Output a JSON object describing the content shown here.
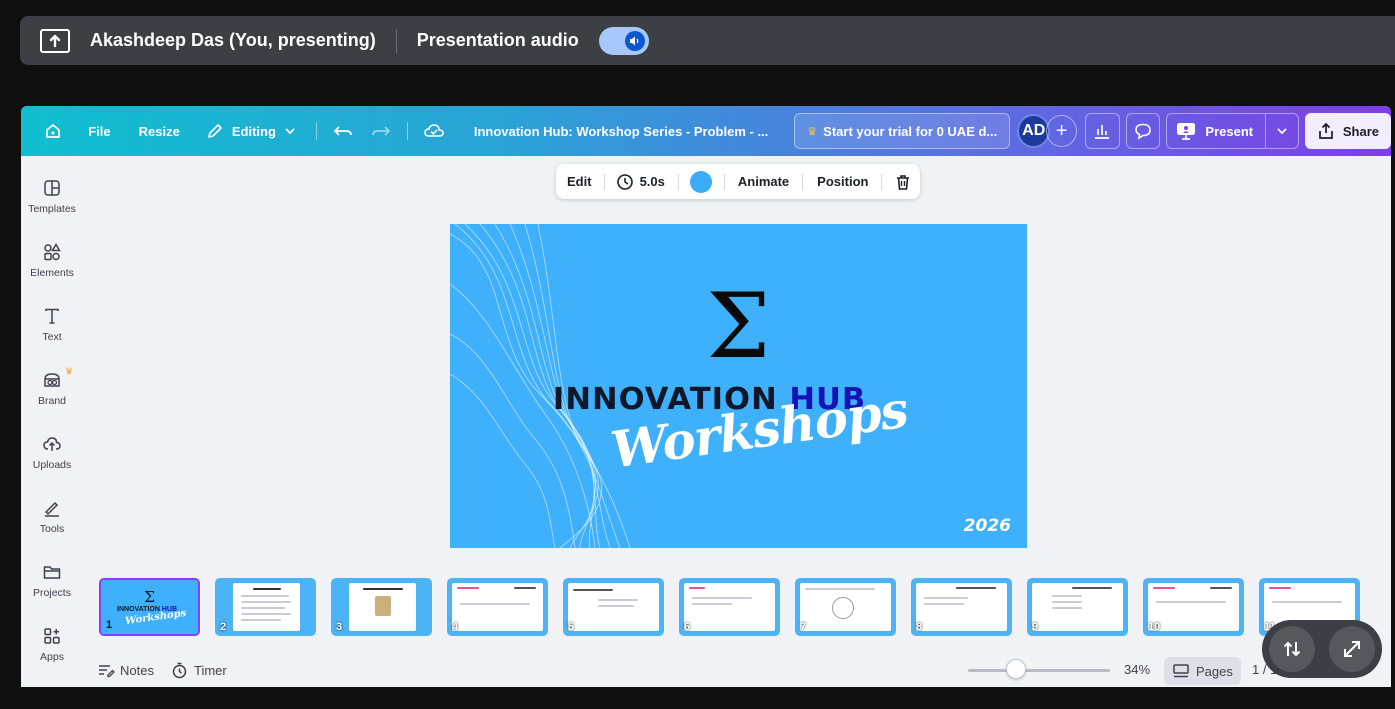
{
  "meet": {
    "presenter": "Akashdeep Das (You, presenting)",
    "audio_label": "Presentation audio",
    "audio_on": true
  },
  "topbar": {
    "file": "File",
    "resize": "Resize",
    "editing": "Editing",
    "doc_title": "Innovation Hub: Workshop Series - Problem - ...",
    "trial": "Start your trial for 0 UAE d...",
    "avatar_initials": "AD",
    "present": "Present",
    "share": "Share",
    "accent": "#7d3fe6"
  },
  "rail": [
    {
      "label": "Templates",
      "icon": "templates-icon"
    },
    {
      "label": "Elements",
      "icon": "elements-icon"
    },
    {
      "label": "Text",
      "icon": "text-icon"
    },
    {
      "label": "Brand",
      "icon": "brand-icon"
    },
    {
      "label": "Uploads",
      "icon": "uploads-icon"
    },
    {
      "label": "Tools",
      "icon": "tools-icon"
    },
    {
      "label": "Projects",
      "icon": "projects-icon"
    },
    {
      "label": "Apps",
      "icon": "apps-icon"
    }
  ],
  "float_toolbar": {
    "edit": "Edit",
    "duration": "5.0s",
    "color": "#3aabf7",
    "animate": "Animate",
    "position": "Position"
  },
  "slide": {
    "symbol": "Σ",
    "title_main": "INNOVATION",
    "title_hub": "HUB",
    "script": "Workshops",
    "year": "2026",
    "background": "#3fb0fb"
  },
  "thumbnails": [
    "1",
    "2",
    "3",
    "4",
    "5",
    "6",
    "7",
    "8",
    "9",
    "10",
    "11"
  ],
  "bottom": {
    "notes": "Notes",
    "timer": "Timer",
    "zoom": "34%",
    "pages": "Pages",
    "page_indicator": "1 / 1"
  }
}
